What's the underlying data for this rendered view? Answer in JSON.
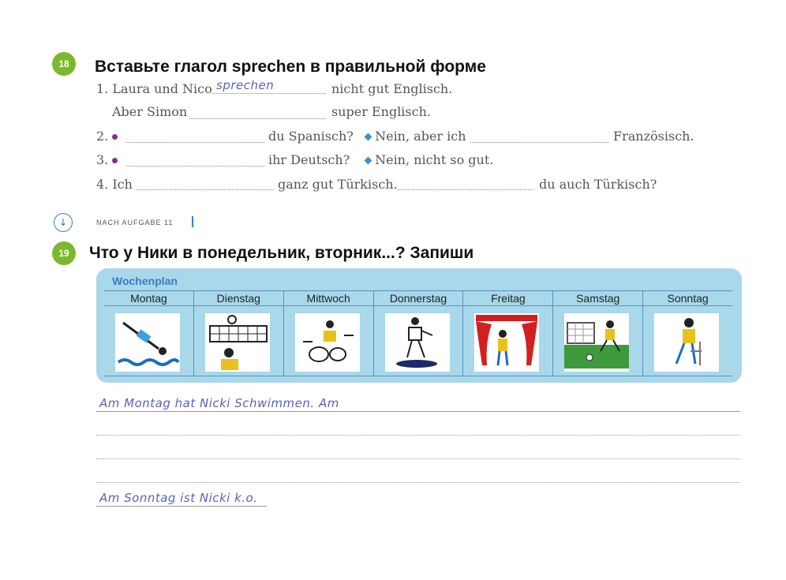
{
  "task18": {
    "number": "18",
    "title": "Вставьте глагол sprechen в правильной форме",
    "l1_prefix": "1. Laura und Nico",
    "l1_answer": "sprechen",
    "l1_suffix": "nicht gut Englisch.",
    "l1b_prefix": "Aber Simon",
    "l1b_suffix": "super Englisch.",
    "l2_num": "2.",
    "l2_mid": "du Spanisch?",
    "l2_resp": "Nein, aber ich",
    "l2_end": "Französisch.",
    "l3_num": "3.",
    "l3_mid": "ihr Deutsch?",
    "l3_resp": "Nein, nicht so gut.",
    "l4_prefix": "4. Ich",
    "l4_mid": "ganz gut Türkisch.",
    "l4_end": "du auch Türkisch?"
  },
  "nach": {
    "label": "NACH AUFGABE 11"
  },
  "task19": {
    "number": "19",
    "title": "Что у Ники в понедельник, вторник...? Запиши",
    "plan_title": "Wochenplan",
    "days": [
      "Montag",
      "Dienstag",
      "Mittwoch",
      "Donnerstag",
      "Freitag",
      "Samstag",
      "Sonntag"
    ],
    "pictures": [
      "swimmer-icon",
      "volleyball-icon",
      "drums-icon",
      "dancer-icon",
      "theater-icon",
      "football-icon",
      "sick-person-icon"
    ],
    "answer_first": "Am Montag hat Nicki Schwimmen. Am",
    "answer_last": "Am Sonntag ist Nicki k.o."
  },
  "colors": {
    "badge": "#7cb82f",
    "plan_bg": "#a8d8ea",
    "handwriting": "#5a63b8",
    "dot": "#8a2c8f",
    "diamond": "#3d8fd1"
  }
}
